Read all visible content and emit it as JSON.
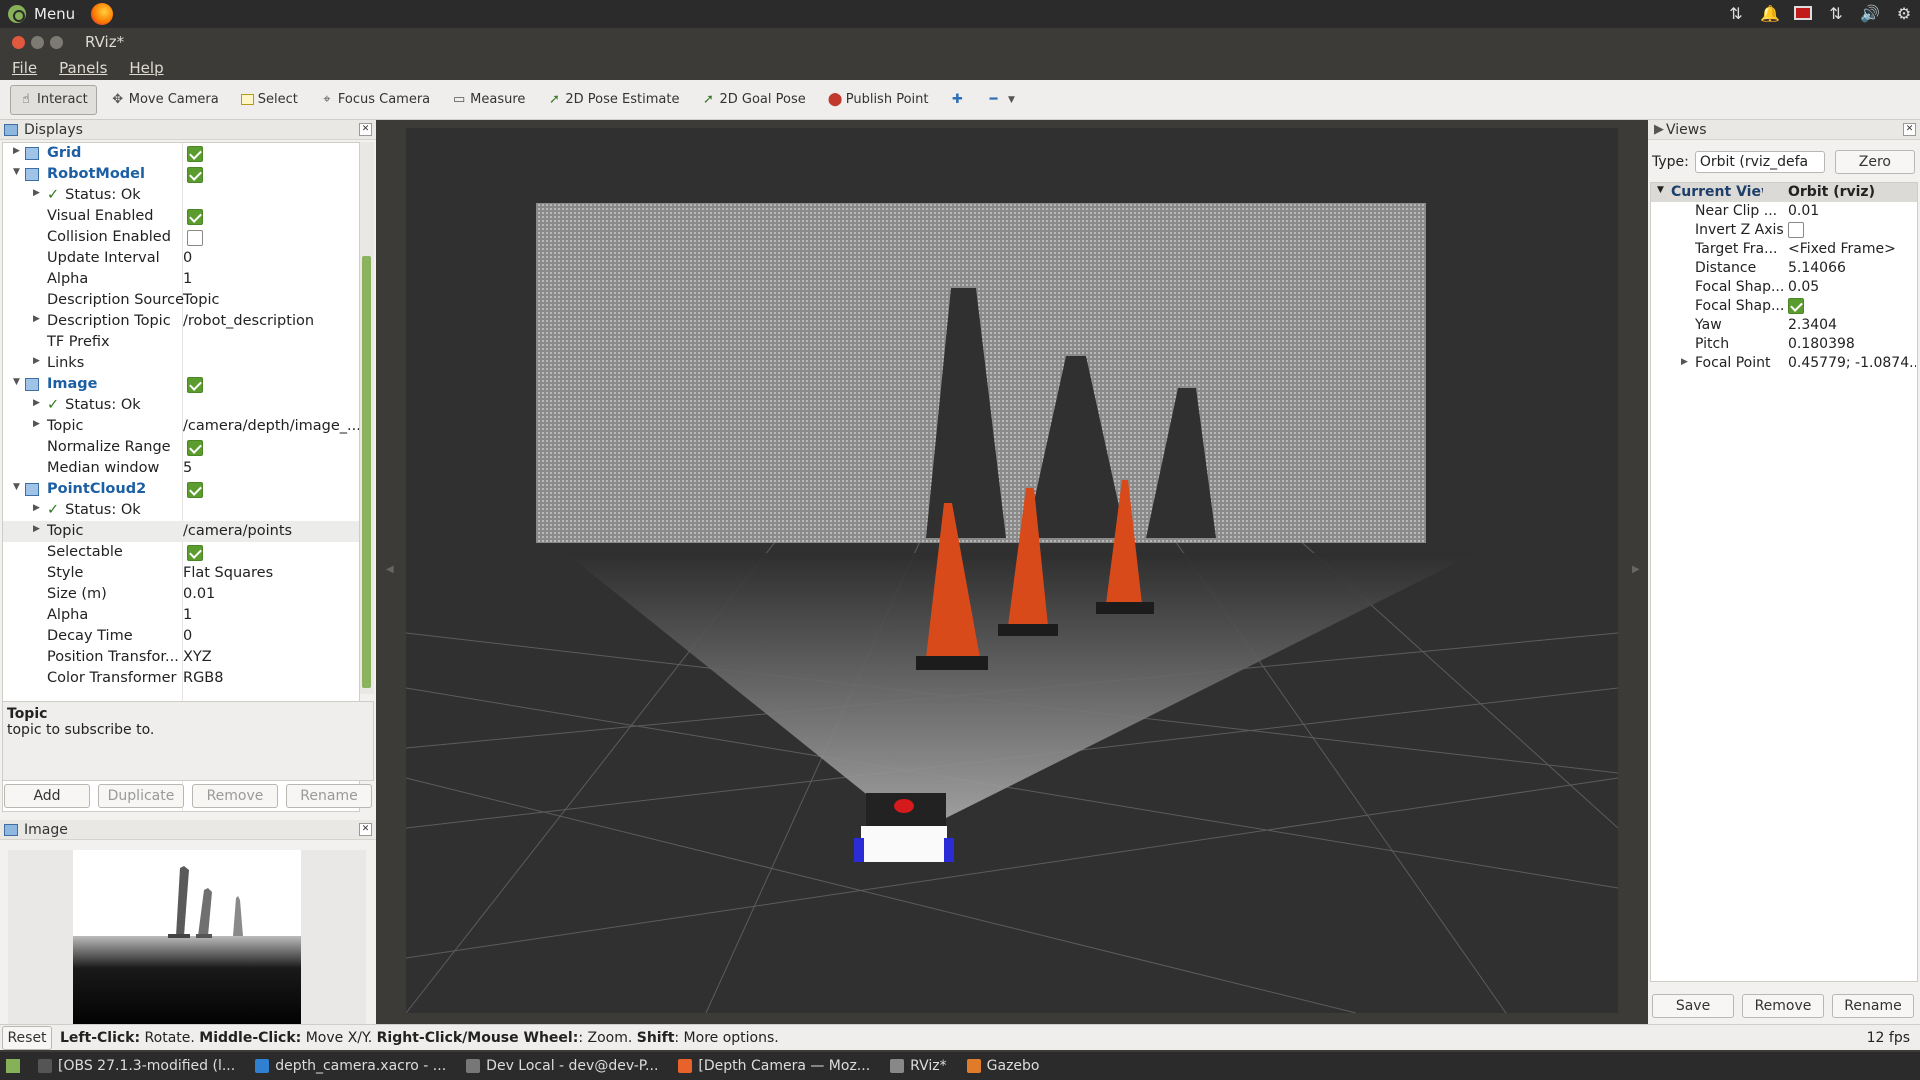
{
  "top_panel": {
    "menu_label": "Menu",
    "tray_icons": [
      "network-icon",
      "bell-icon",
      "record-icon",
      "transfer-icon",
      "volume-icon",
      "settings-icon"
    ]
  },
  "window": {
    "title": "RViz*"
  },
  "menubar": {
    "items": [
      "File",
      "Panels",
      "Help"
    ]
  },
  "toolbar": {
    "tools": [
      {
        "label": "Interact",
        "icon": "hand-icon",
        "active": true
      },
      {
        "label": "Move Camera",
        "icon": "move-camera-icon"
      },
      {
        "label": "Select",
        "icon": "select-icon"
      },
      {
        "label": "Focus Camera",
        "icon": "crosshair-icon"
      },
      {
        "label": "Measure",
        "icon": "ruler-icon"
      },
      {
        "label": "2D Pose Estimate",
        "icon": "green-arrow-icon"
      },
      {
        "label": "2D Goal Pose",
        "icon": "green-arrow-icon"
      },
      {
        "label": "Publish Point",
        "icon": "map-pin-icon"
      }
    ]
  },
  "displays": {
    "title": "Displays",
    "rows": [
      {
        "name": "Grid",
        "kind": "display",
        "indent": 0,
        "check": true,
        "expanded": false
      },
      {
        "name": "RobotModel",
        "kind": "display",
        "indent": 0,
        "check": true,
        "expanded": true
      },
      {
        "name": "Status: Ok",
        "kind": "status",
        "indent": 1
      },
      {
        "name": "Visual Enabled",
        "indent": 1,
        "check": true
      },
      {
        "name": "Collision Enabled",
        "indent": 1,
        "check": false
      },
      {
        "name": "Update Interval",
        "indent": 1,
        "value": "0"
      },
      {
        "name": "Alpha",
        "indent": 1,
        "value": "1"
      },
      {
        "name": "Description Source",
        "indent": 1,
        "value": "Topic"
      },
      {
        "name": "Description Topic",
        "indent": 1,
        "value": "/robot_description",
        "arrow": true
      },
      {
        "name": "TF Prefix",
        "indent": 1,
        "value": ""
      },
      {
        "name": "Links",
        "indent": 1,
        "arrow": true
      },
      {
        "name": "Image",
        "kind": "display",
        "indent": 0,
        "check": true,
        "expanded": true
      },
      {
        "name": "Status: Ok",
        "kind": "status",
        "indent": 1
      },
      {
        "name": "Topic",
        "indent": 1,
        "value": "/camera/depth/image_...",
        "arrow": true
      },
      {
        "name": "Normalize Range",
        "indent": 1,
        "check": true
      },
      {
        "name": "Median window",
        "indent": 1,
        "value": "5"
      },
      {
        "name": "PointCloud2",
        "kind": "display",
        "indent": 0,
        "check": true,
        "expanded": true
      },
      {
        "name": "Status: Ok",
        "kind": "status",
        "indent": 1
      },
      {
        "name": "Topic",
        "indent": 1,
        "value": "/camera/points",
        "arrow": true,
        "selected": true
      },
      {
        "name": "Selectable",
        "indent": 1,
        "check": true
      },
      {
        "name": "Style",
        "indent": 1,
        "value": "Flat Squares"
      },
      {
        "name": "Size (m)",
        "indent": 1,
        "value": "0.01"
      },
      {
        "name": "Alpha",
        "indent": 1,
        "value": "1"
      },
      {
        "name": "Decay Time",
        "indent": 1,
        "value": "0"
      },
      {
        "name": "Position Transfor...",
        "indent": 1,
        "value": "XYZ"
      },
      {
        "name": "Color Transformer",
        "indent": 1,
        "value": "RGB8"
      }
    ],
    "description_title": "Topic",
    "description_text": "topic to subscribe to.",
    "buttons": [
      "Add",
      "Duplicate",
      "Remove",
      "Rename"
    ]
  },
  "image_panel": {
    "title": "Image"
  },
  "views": {
    "title": "Views",
    "type_label": "Type:",
    "type_value": "Orbit (rviz_defa",
    "zero_label": "Zero",
    "header": {
      "name": "Current View",
      "value": "Orbit (rviz)"
    },
    "rows": [
      {
        "name": "Near Clip ...",
        "value": "0.01"
      },
      {
        "name": "Invert Z Axis",
        "check": false
      },
      {
        "name": "Target Fra...",
        "value": "<Fixed Frame>"
      },
      {
        "name": "Distance",
        "value": "5.14066"
      },
      {
        "name": "Focal Shap...",
        "value": "0.05"
      },
      {
        "name": "Focal Shap...",
        "check": true
      },
      {
        "name": "Yaw",
        "value": "2.3404"
      },
      {
        "name": "Pitch",
        "value": "0.180398"
      },
      {
        "name": "Focal Point",
        "value": "0.45779; -1.0874...",
        "arrow": true
      }
    ],
    "buttons": [
      "Save",
      "Remove",
      "Rename"
    ]
  },
  "statusbar": {
    "reset": "Reset",
    "l1": "Left-Click:",
    "t1": " Rotate. ",
    "l2": "Middle-Click:",
    "t2": " Move X/Y. ",
    "l3": "Right-Click/Mouse Wheel:",
    "t3": ": Zoom. ",
    "l4": "Shift",
    "t4": ": More options.",
    "fps": "12 fps"
  },
  "taskbar": {
    "tasks": [
      {
        "label": "[OBS 27.1.3-modified (l...",
        "color": "#555"
      },
      {
        "label": "depth_camera.xacro - ...",
        "color": "#2f80d0"
      },
      {
        "label": "Dev Local - dev@dev-P...",
        "color": "#777"
      },
      {
        "label": "[Depth Camera — Moz...",
        "color": "#e8632b"
      },
      {
        "label": "RViz*",
        "color": "#888"
      },
      {
        "label": "Gazebo",
        "color": "#e07b2a"
      }
    ]
  }
}
